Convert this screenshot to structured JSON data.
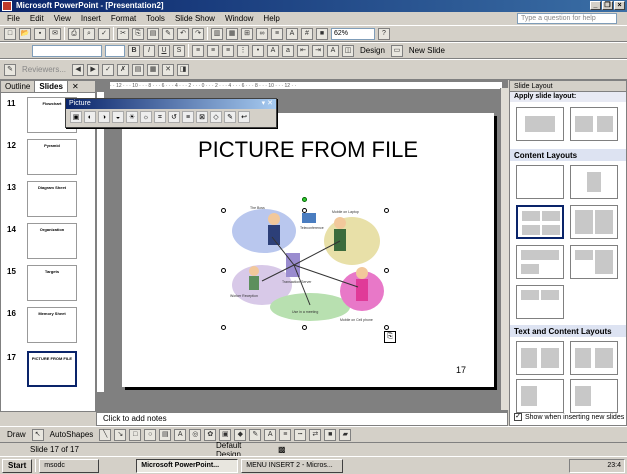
{
  "window": {
    "title": "Microsoft PowerPoint - [Presentation2]"
  },
  "menu": {
    "items": [
      "File",
      "Edit",
      "View",
      "Insert",
      "Format",
      "Tools",
      "Slide Show",
      "Window",
      "Help"
    ],
    "ask_placeholder": "Type a question for help"
  },
  "toolbar": {
    "zoom": "62%",
    "reviewers": "Reviewers...",
    "design": "Design",
    "new_slide": "New Slide"
  },
  "outline_tabs": {
    "outline": "Outline",
    "slides": "Slides"
  },
  "thumbnails": [
    {
      "num": "11",
      "title": "Flowchart",
      "selected": false
    },
    {
      "num": "12",
      "title": "Pyramid",
      "selected": false
    },
    {
      "num": "13",
      "title": "Diagram Sheet",
      "selected": false
    },
    {
      "num": "14",
      "title": "Organization",
      "selected": false
    },
    {
      "num": "15",
      "title": "Targets",
      "selected": false
    },
    {
      "num": "16",
      "title": "Memory Sheet",
      "selected": false
    },
    {
      "num": "17",
      "title": "PICTURE FROM FILE",
      "selected": true
    }
  ],
  "picture_toolbar": {
    "title": "Picture"
  },
  "slide": {
    "title": "PICTURE FROM FILE",
    "number": "17"
  },
  "clipart_labels": [
    "The Boss",
    "Mobile on Laptop",
    "Teleconference",
    "Worker Reception",
    "Transaction Server",
    "Use in a meeting",
    "Mobile on Cell phone"
  ],
  "notes": {
    "placeholder": "Click to add notes"
  },
  "task_pane": {
    "header": "Slide Layout",
    "apply": "Apply slide layout:",
    "content_layouts": "Content Layouts",
    "text_content_layouts": "Text and Content Layouts",
    "show_when": "Show when inserting new slides"
  },
  "drawing": {
    "draw": "Draw",
    "autoshapes": "AutoShapes"
  },
  "status": {
    "slide": "Slide 17 of 17",
    "design": "Default Design"
  },
  "taskbar": {
    "start": "Start",
    "tasks": [
      "msodc",
      "Microsoft PowerPoint...",
      "MENU INSERT 2 - Micros..."
    ],
    "clock": "23:4"
  }
}
